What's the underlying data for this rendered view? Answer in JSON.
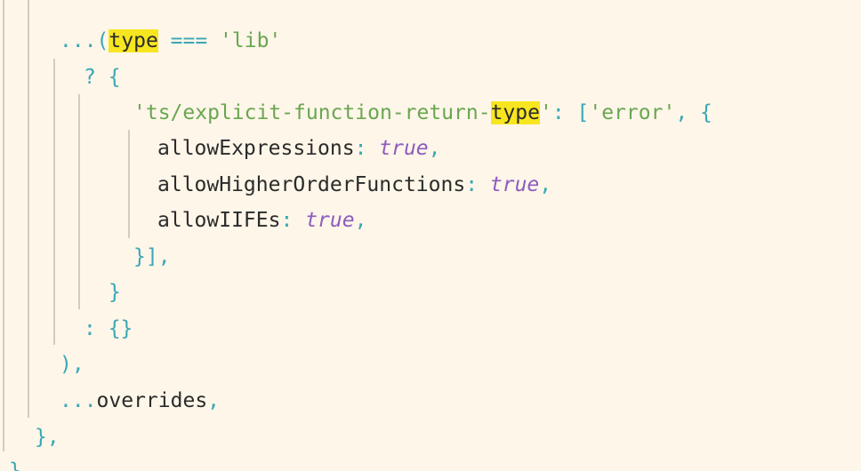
{
  "code": {
    "l1": {
      "spread": "...",
      "open_paren": "(",
      "ident": "type",
      "op": " === ",
      "str": "'lib'"
    },
    "l2": {
      "q": "?",
      "brace": " {"
    },
    "l3": {
      "str_open": "'ts/explicit-function-return-",
      "highlight": "type",
      "str_close": "'",
      "colon": ": ",
      "bracket": "[",
      "err": "'error'",
      "rest": ", {"
    },
    "l4": {
      "key": "allowExpressions",
      "colon": ": ",
      "val": "true",
      "comma": ","
    },
    "l5": {
      "key": "allowHigherOrderFunctions",
      "colon": ": ",
      "val": "true",
      "comma": ","
    },
    "l6": {
      "key": "allowIIFEs",
      "colon": ": ",
      "val": "true",
      "comma": ","
    },
    "l7": {
      "text": "}],"
    },
    "l8": {
      "text": "}"
    },
    "l9": {
      "text": ": {}"
    },
    "l10": {
      "text": "),"
    },
    "l11": {
      "spread": "...",
      "ident": "overrides",
      "comma": ","
    },
    "l12": {
      "text": "},"
    },
    "l13": {
      "text": "}"
    }
  },
  "colors": {
    "background": "#fdf6e9",
    "punctuation": "#3aa7b5",
    "string": "#6aa650",
    "keyword": "#8e5bbf",
    "highlight": "#f7e61f",
    "text": "#2b2b2b"
  }
}
